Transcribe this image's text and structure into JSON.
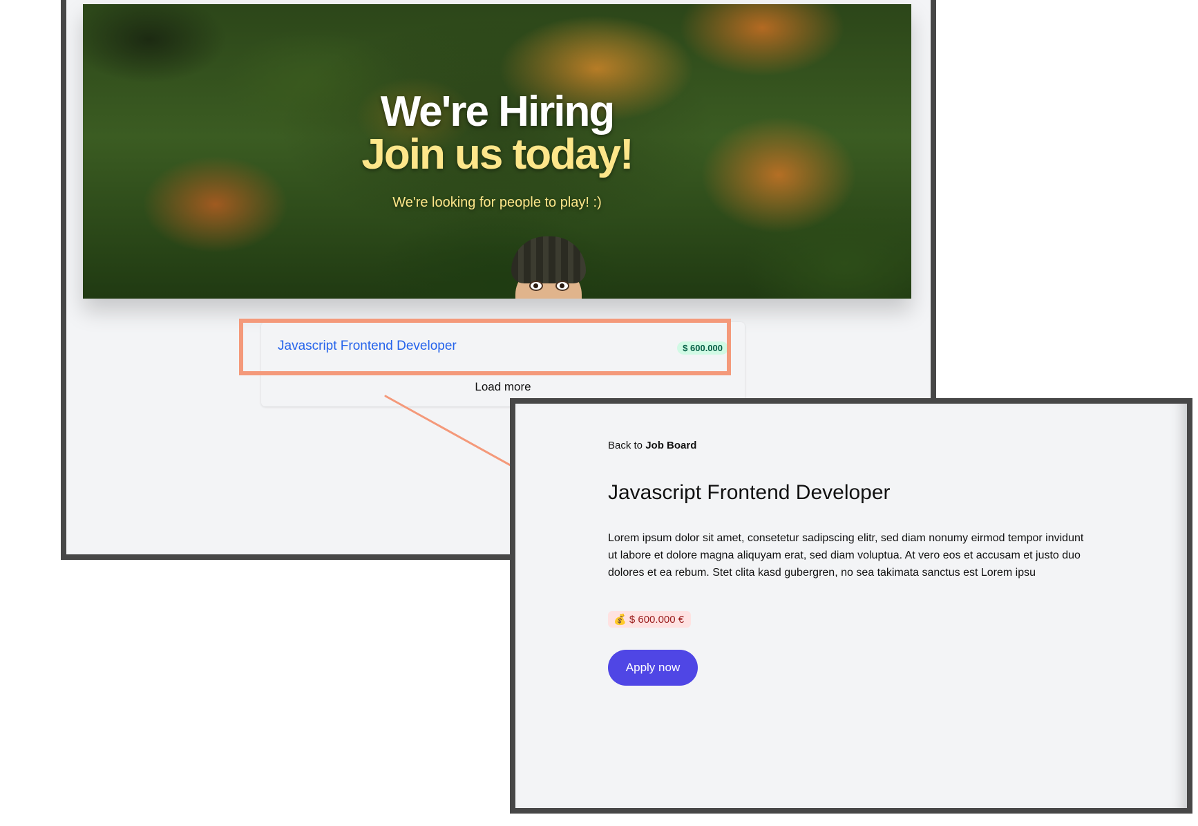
{
  "hero": {
    "title_line1": "We're Hiring",
    "title_line2": "Join us today!",
    "subtitle": "We're looking for people to play! :)"
  },
  "jobs": [
    {
      "title": "Javascript Frontend Developer",
      "salary": "$ 600.000"
    }
  ],
  "board": {
    "load_more_label": "Load more"
  },
  "detail": {
    "back_prefix": "Back to",
    "back_target": "Job Board",
    "title": "Javascript Frontend Developer",
    "description": "Lorem ipsum dolor sit amet, consetetur sadipscing elitr, sed diam nonumy eirmod tempor invidunt ut labore et dolore magna aliquyam erat, sed diam voluptua. At vero eos et accusam et justo duo dolores et ea rebum. Stet clita kasd gubergren, no sea takimata sanctus est Lorem ipsu",
    "salary_icon": "money-bag-icon",
    "salary_text": "$ 600.000 €",
    "apply_label": "Apply now"
  },
  "colors": {
    "highlight": "#f4997a",
    "link": "#2563eb",
    "apply": "#4f46e5",
    "window_border": "#474747"
  }
}
